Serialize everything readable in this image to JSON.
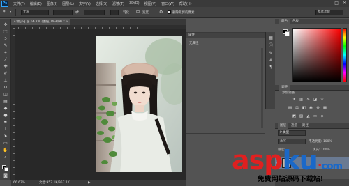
{
  "app": {
    "logo": "Ps",
    "window_controls": [
      "—",
      "□",
      "✕"
    ]
  },
  "menubar": [
    "文件(F)",
    "编辑(E)",
    "图像(I)",
    "图层(L)",
    "文字(Y)",
    "选择(S)",
    "滤镜(T)",
    "3D(D)",
    "视图(V)",
    "窗口(W)",
    "帮助(H)"
  ],
  "options": {
    "mode_select": "无限",
    "label_1": "羽化",
    "label_2": "宽度",
    "label_3": "对比度",
    "checkbox_label": "删除裁剪的像素",
    "workspace_select": "基本功能"
  },
  "document": {
    "tab_label": "人物.jpg @ 66.7% (图层, RGB/8) *",
    "close_glyph": "×",
    "zoom": "66.67%",
    "doc_size": "文档:957.1K/957.1K"
  },
  "properties": {
    "title": "属性",
    "body_label": "无属性"
  },
  "color_panel": {
    "tabs": [
      "颜色",
      "色板"
    ]
  },
  "adjustments": {
    "tab": "调整",
    "title": "添加调整"
  },
  "layers": {
    "tabs": [
      "图层",
      "通道",
      "路径"
    ],
    "kind": "P 类型",
    "blend_mode": "正常",
    "opacity_label": "不透明度: 100%",
    "fill_label": "填充: 100%",
    "lock_label": "锁定:"
  },
  "watermark": {
    "main_a": "asp",
    "main_b": "ku",
    "dot": "·",
    "suffix": "com",
    "sub": "免费网站源码下载站!"
  },
  "colors": {
    "accent": "#31a8ff",
    "bg": "#535353",
    "panel": "#424242"
  }
}
